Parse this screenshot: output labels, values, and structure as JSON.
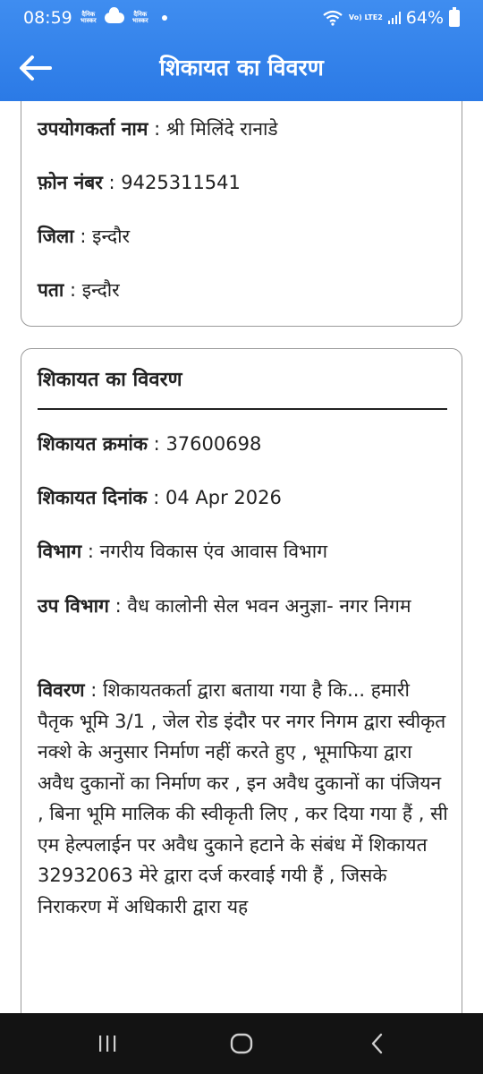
{
  "status_bar": {
    "time": "08:59",
    "app_icon_text": "दैनिक भास्कर",
    "network": "Vo) LTE2",
    "battery": "64%"
  },
  "app_bar": {
    "title": "शिकायत का विवरण",
    "back_icon": "arrow-left-icon"
  },
  "user_details": [
    {
      "label": "उपयोगकर्ता नाम",
      "value": "श्री मिलिंदे रानाडे"
    },
    {
      "label": "फ़ोन नंबर",
      "value": "9425311541"
    },
    {
      "label": "जिला",
      "value": "इन्दौर"
    },
    {
      "label": "पता",
      "value": "इन्दौर"
    }
  ],
  "complaint": {
    "title": "शिकायत का विवरण",
    "fields": [
      {
        "label": "शिकायत क्रमांक",
        "value": "37600698"
      },
      {
        "label": "शिकायत दिनांक",
        "value": "04 Apr 2026"
      },
      {
        "label": "विभाग",
        "value": "नगरीय विकास एंव आवास विभाग"
      },
      {
        "label": "उप विभाग",
        "value": "वैध कालोनी सेल भवन अनुज्ञा- नगर निगम"
      },
      {
        "label": "विवरण",
        "value": "शिकायतकर्ता द्वारा बताया गया है कि... हमारी पैतृक भूमि 3/1 , जेल रोड इंदौर पर नगर निगम द्वारा स्वीकृत नक्शे के अनुसार निर्माण नहीं करते हुए , भूमाफिया द्वारा अवैध दुकानों का निर्माण कर , इन अवैध दुकानों का पंजियन , बिना भूमि मालिक की स्वीकृती लिए , कर दिया गया हैं , सी एम हेल्पलाईन पर अवैध दुकाने हटाने के संबंध में शिकायत 32932063 मेरे द्वारा दर्ज करवाई गयी हैं ,  जिसके निराकरण में अधिकारी द्वारा यह"
      }
    ]
  },
  "separator": " : ",
  "colors": {
    "header": "#2b7ae6",
    "nav_bar": "#131313",
    "card_border": "#9a9a9a"
  },
  "nav": {
    "recents_icon": "recents-icon",
    "home_icon": "home-icon",
    "back_icon": "chevron-left-icon"
  }
}
